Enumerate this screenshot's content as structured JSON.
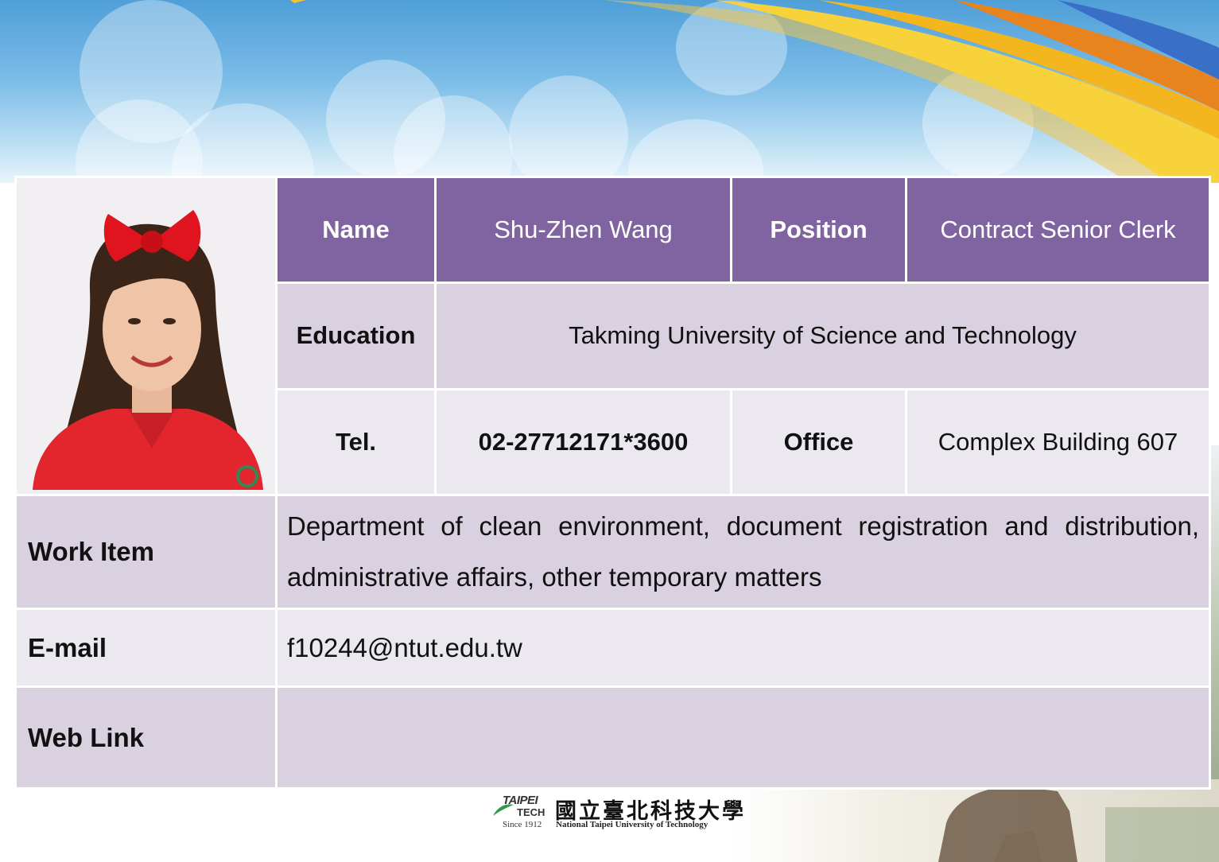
{
  "profile": {
    "name_label": "Name",
    "name_value": "Shu-Zhen Wang",
    "position_label": "Position",
    "position_value": "Contract Senior Clerk",
    "education_label": "Education",
    "education_value": "Takming University of Science and Technology",
    "tel_label": "Tel.",
    "tel_value": "02-27712171*3600",
    "office_label": "Office",
    "office_value": "Complex Building 607",
    "work_label": "Work Item",
    "work_value": "Department of clean environment, document registration and distribution, administrative affairs, other temporary matters",
    "email_label": "E-mail",
    "email_value": "f10244@ntut.edu.tw",
    "web_label": "Web Link",
    "web_value": ""
  },
  "logo": {
    "taipei": "TAIPEI",
    "tech": "TECH",
    "since": "Since 1912",
    "chinese_name": "國立臺北科技大學",
    "english_name": "National Taipei University of Technology"
  },
  "colors": {
    "header_purple": "#8064a2",
    "row_dark": "#d9d1e0",
    "row_light": "#ece8ef"
  }
}
